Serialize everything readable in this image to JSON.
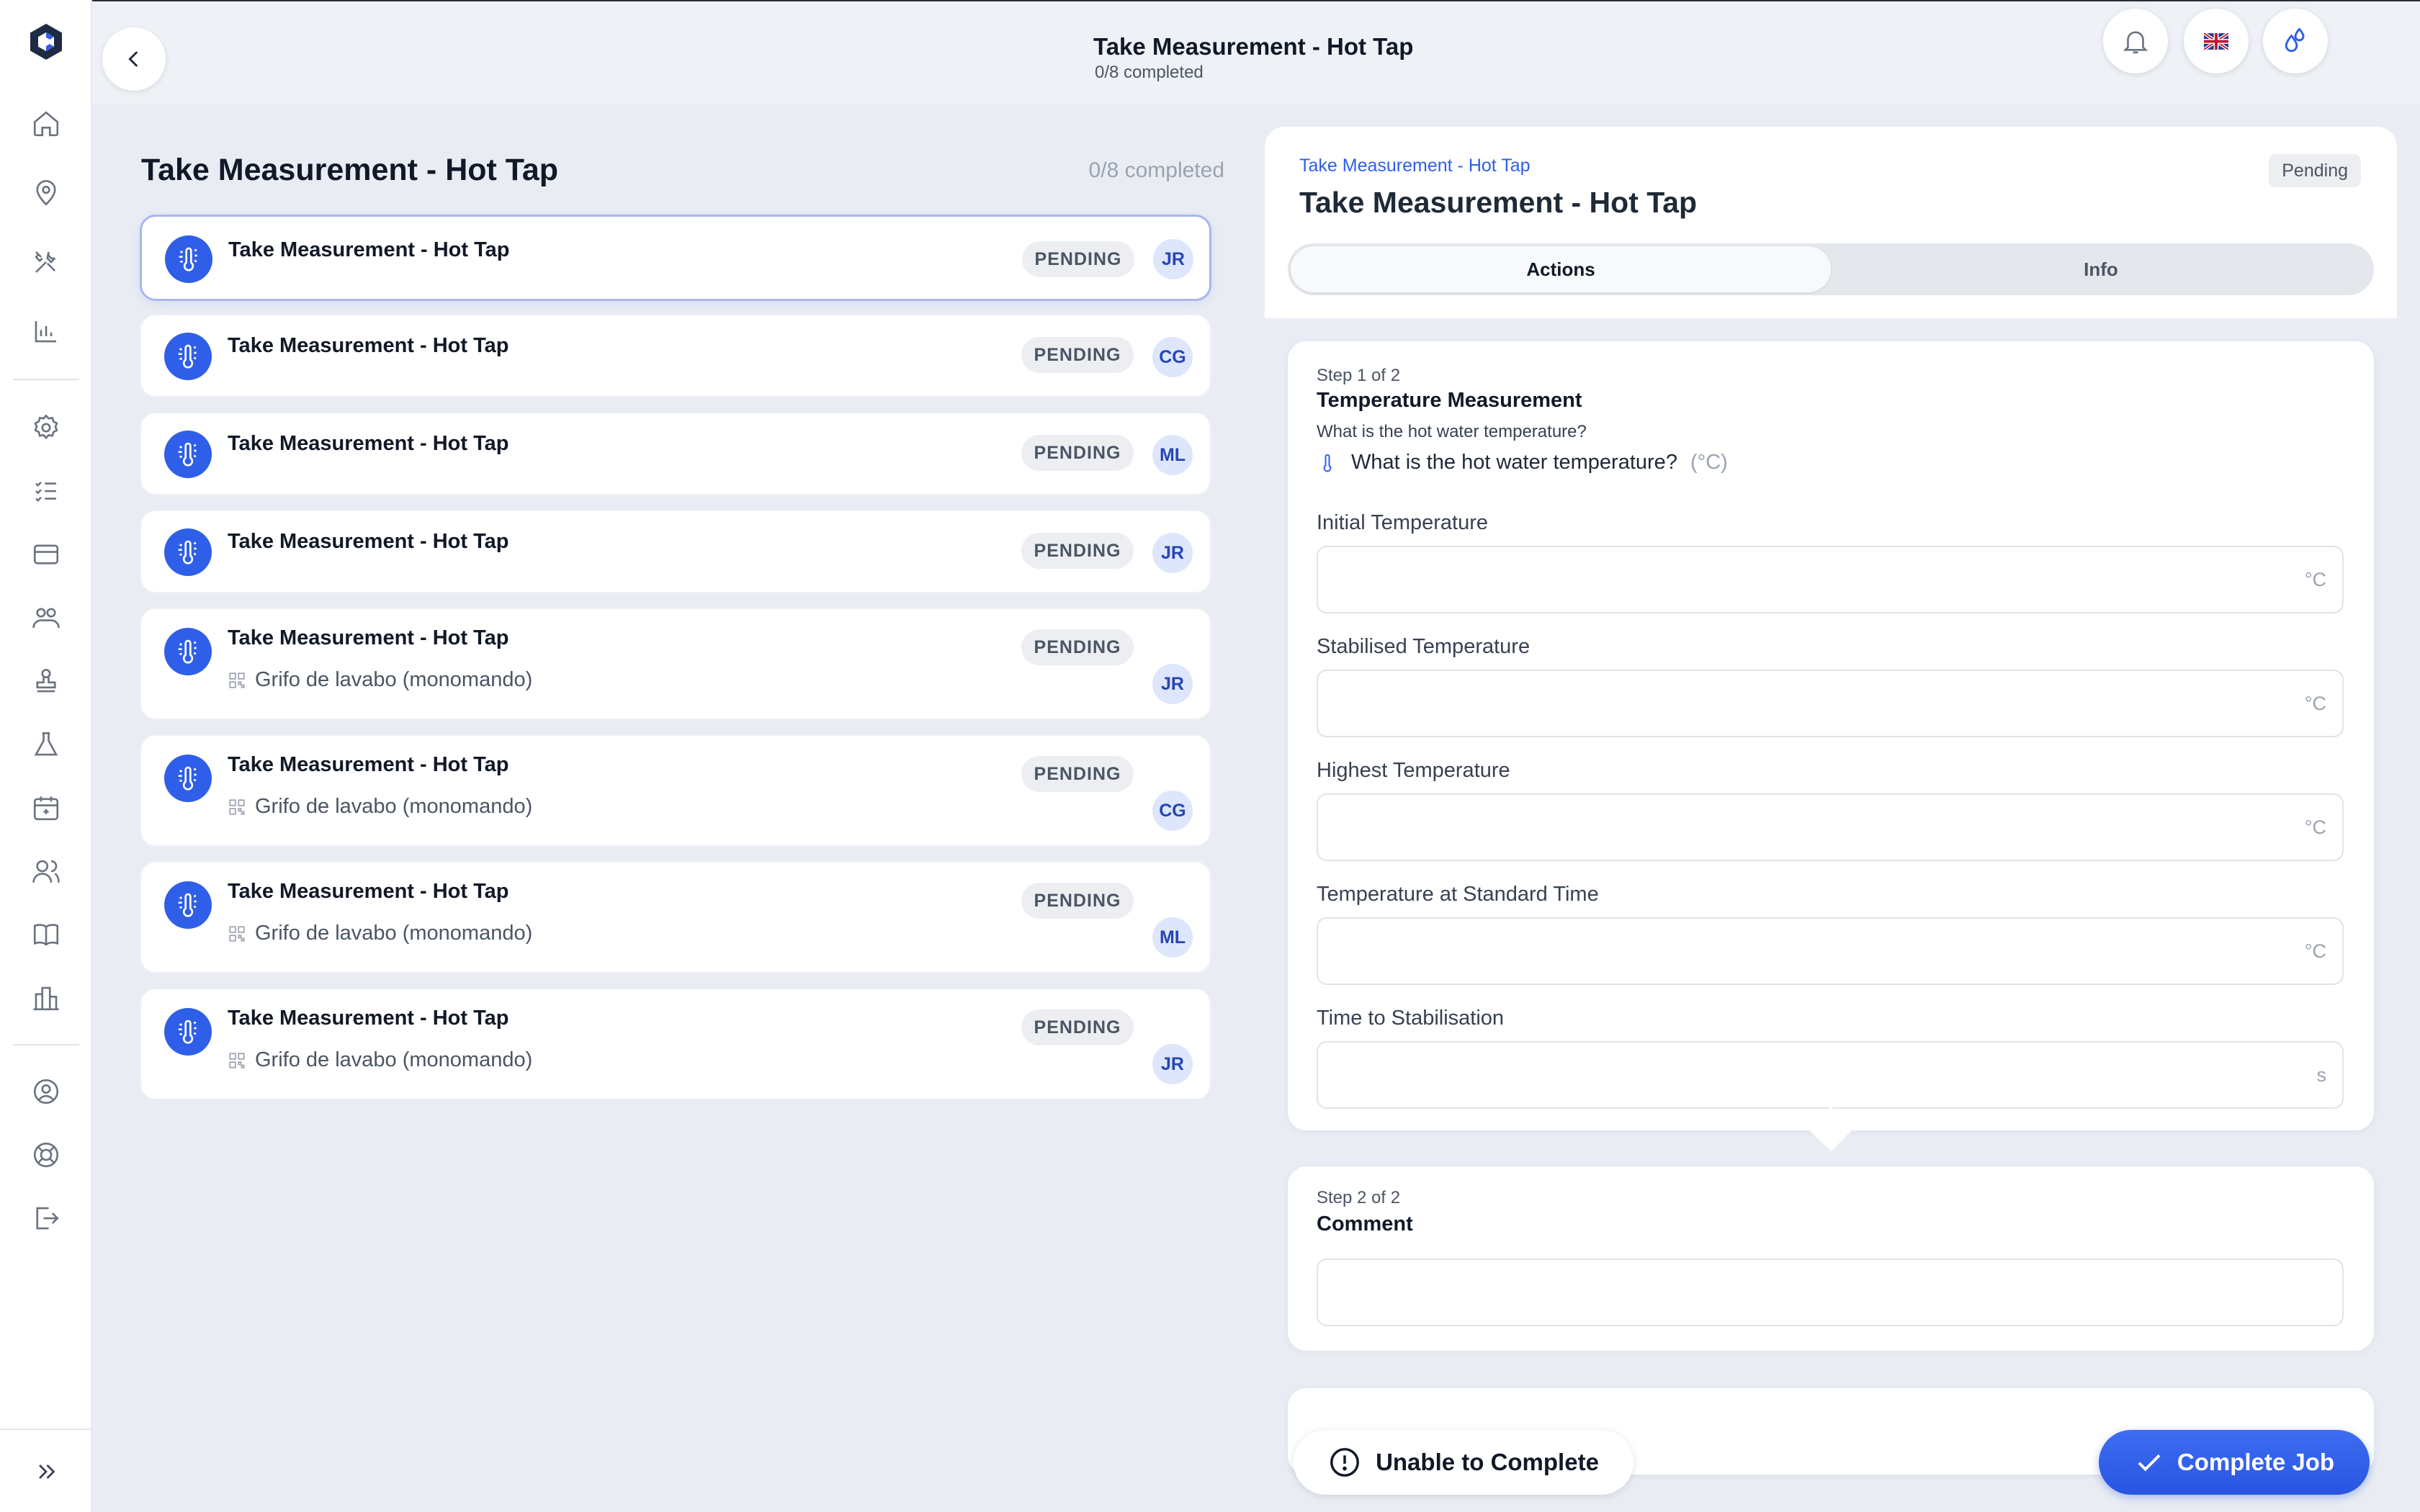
{
  "header": {
    "title": "Take Measurement - Hot Tap",
    "subtitle": "0/8 completed"
  },
  "sidebar": {
    "items": [
      {
        "icon": "home-icon"
      },
      {
        "icon": "location-pin-icon"
      },
      {
        "icon": "tools-icon"
      },
      {
        "icon": "bar-chart-icon"
      },
      {
        "icon": "gear-icon"
      },
      {
        "icon": "checklist-icon"
      },
      {
        "icon": "card-icon"
      },
      {
        "icon": "team-icon"
      },
      {
        "icon": "stamp-icon"
      },
      {
        "icon": "flask-icon"
      },
      {
        "icon": "calendar-icon"
      },
      {
        "icon": "users-icon"
      },
      {
        "icon": "book-icon"
      },
      {
        "icon": "building-icon"
      },
      {
        "icon": "account-icon"
      },
      {
        "icon": "lifebuoy-icon"
      },
      {
        "icon": "logout-icon"
      }
    ]
  },
  "list": {
    "title": "Take Measurement - Hot Tap",
    "progress": "0/8 completed",
    "items": [
      {
        "title": "Take Measurement - Hot Tap",
        "status": "PENDING",
        "assignee": "JR",
        "asset": ""
      },
      {
        "title": "Take Measurement - Hot Tap",
        "status": "PENDING",
        "assignee": "CG",
        "asset": ""
      },
      {
        "title": "Take Measurement - Hot Tap",
        "status": "PENDING",
        "assignee": "ML",
        "asset": ""
      },
      {
        "title": "Take Measurement - Hot Tap",
        "status": "PENDING",
        "assignee": "JR",
        "asset": ""
      },
      {
        "title": "Take Measurement - Hot Tap",
        "status": "PENDING",
        "assignee": "JR",
        "asset": "Grifo de lavabo (monomando)"
      },
      {
        "title": "Take Measurement - Hot Tap",
        "status": "PENDING",
        "assignee": "CG",
        "asset": "Grifo de lavabo (monomando)"
      },
      {
        "title": "Take Measurement - Hot Tap",
        "status": "PENDING",
        "assignee": "ML",
        "asset": "Grifo de lavabo (monomando)"
      },
      {
        "title": "Take Measurement - Hot Tap",
        "status": "PENDING",
        "assignee": "JR",
        "asset": "Grifo de lavabo (monomando)"
      }
    ]
  },
  "detail": {
    "breadcrumb": "Take Measurement - Hot Tap",
    "title": "Take Measurement - Hot Tap",
    "status": "Pending",
    "tabs": [
      {
        "label": "Actions",
        "active": true
      },
      {
        "label": "Info",
        "active": false
      }
    ],
    "step1": {
      "label": "Step 1 of 2",
      "title": "Temperature Measurement",
      "question": "What is the hot water temperature?",
      "prompt": "What is the hot water temperature?",
      "prompt_unit": "(°C)",
      "fields": [
        {
          "label": "Initial Temperature",
          "unit": "°C",
          "value": ""
        },
        {
          "label": "Stabilised Temperature",
          "unit": "°C",
          "value": ""
        },
        {
          "label": "Highest Temperature",
          "unit": "°C",
          "value": ""
        },
        {
          "label": "Temperature at Standard Time",
          "unit": "°C",
          "value": ""
        },
        {
          "label": "Time to Stabilisation",
          "unit": "s",
          "value": ""
        }
      ]
    },
    "step2": {
      "label": "Step 2 of 2",
      "title": "Comment",
      "value": ""
    }
  },
  "actions": {
    "unable_label": "Unable to Complete",
    "complete_label": "Complete Job"
  },
  "colors": {
    "accent": "#2f5fe8",
    "background": "#e9edf3",
    "badge_bg": "#eceef2",
    "avatar_bg": "#dde6fb"
  }
}
